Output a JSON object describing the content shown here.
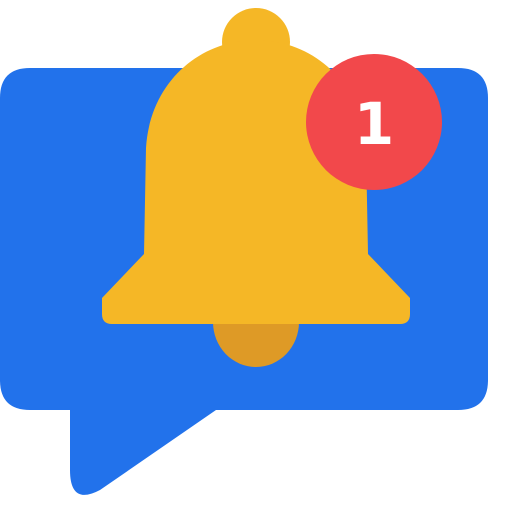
{
  "icon": {
    "name": "notification-bell-chat-icon",
    "colors": {
      "bubble": "#2272EB",
      "bell": "#F5B726",
      "clapper": "#DE9A26",
      "badge": "#F2484B",
      "badge_text": "#FFFFFF"
    }
  },
  "badge": {
    "count": "1"
  }
}
